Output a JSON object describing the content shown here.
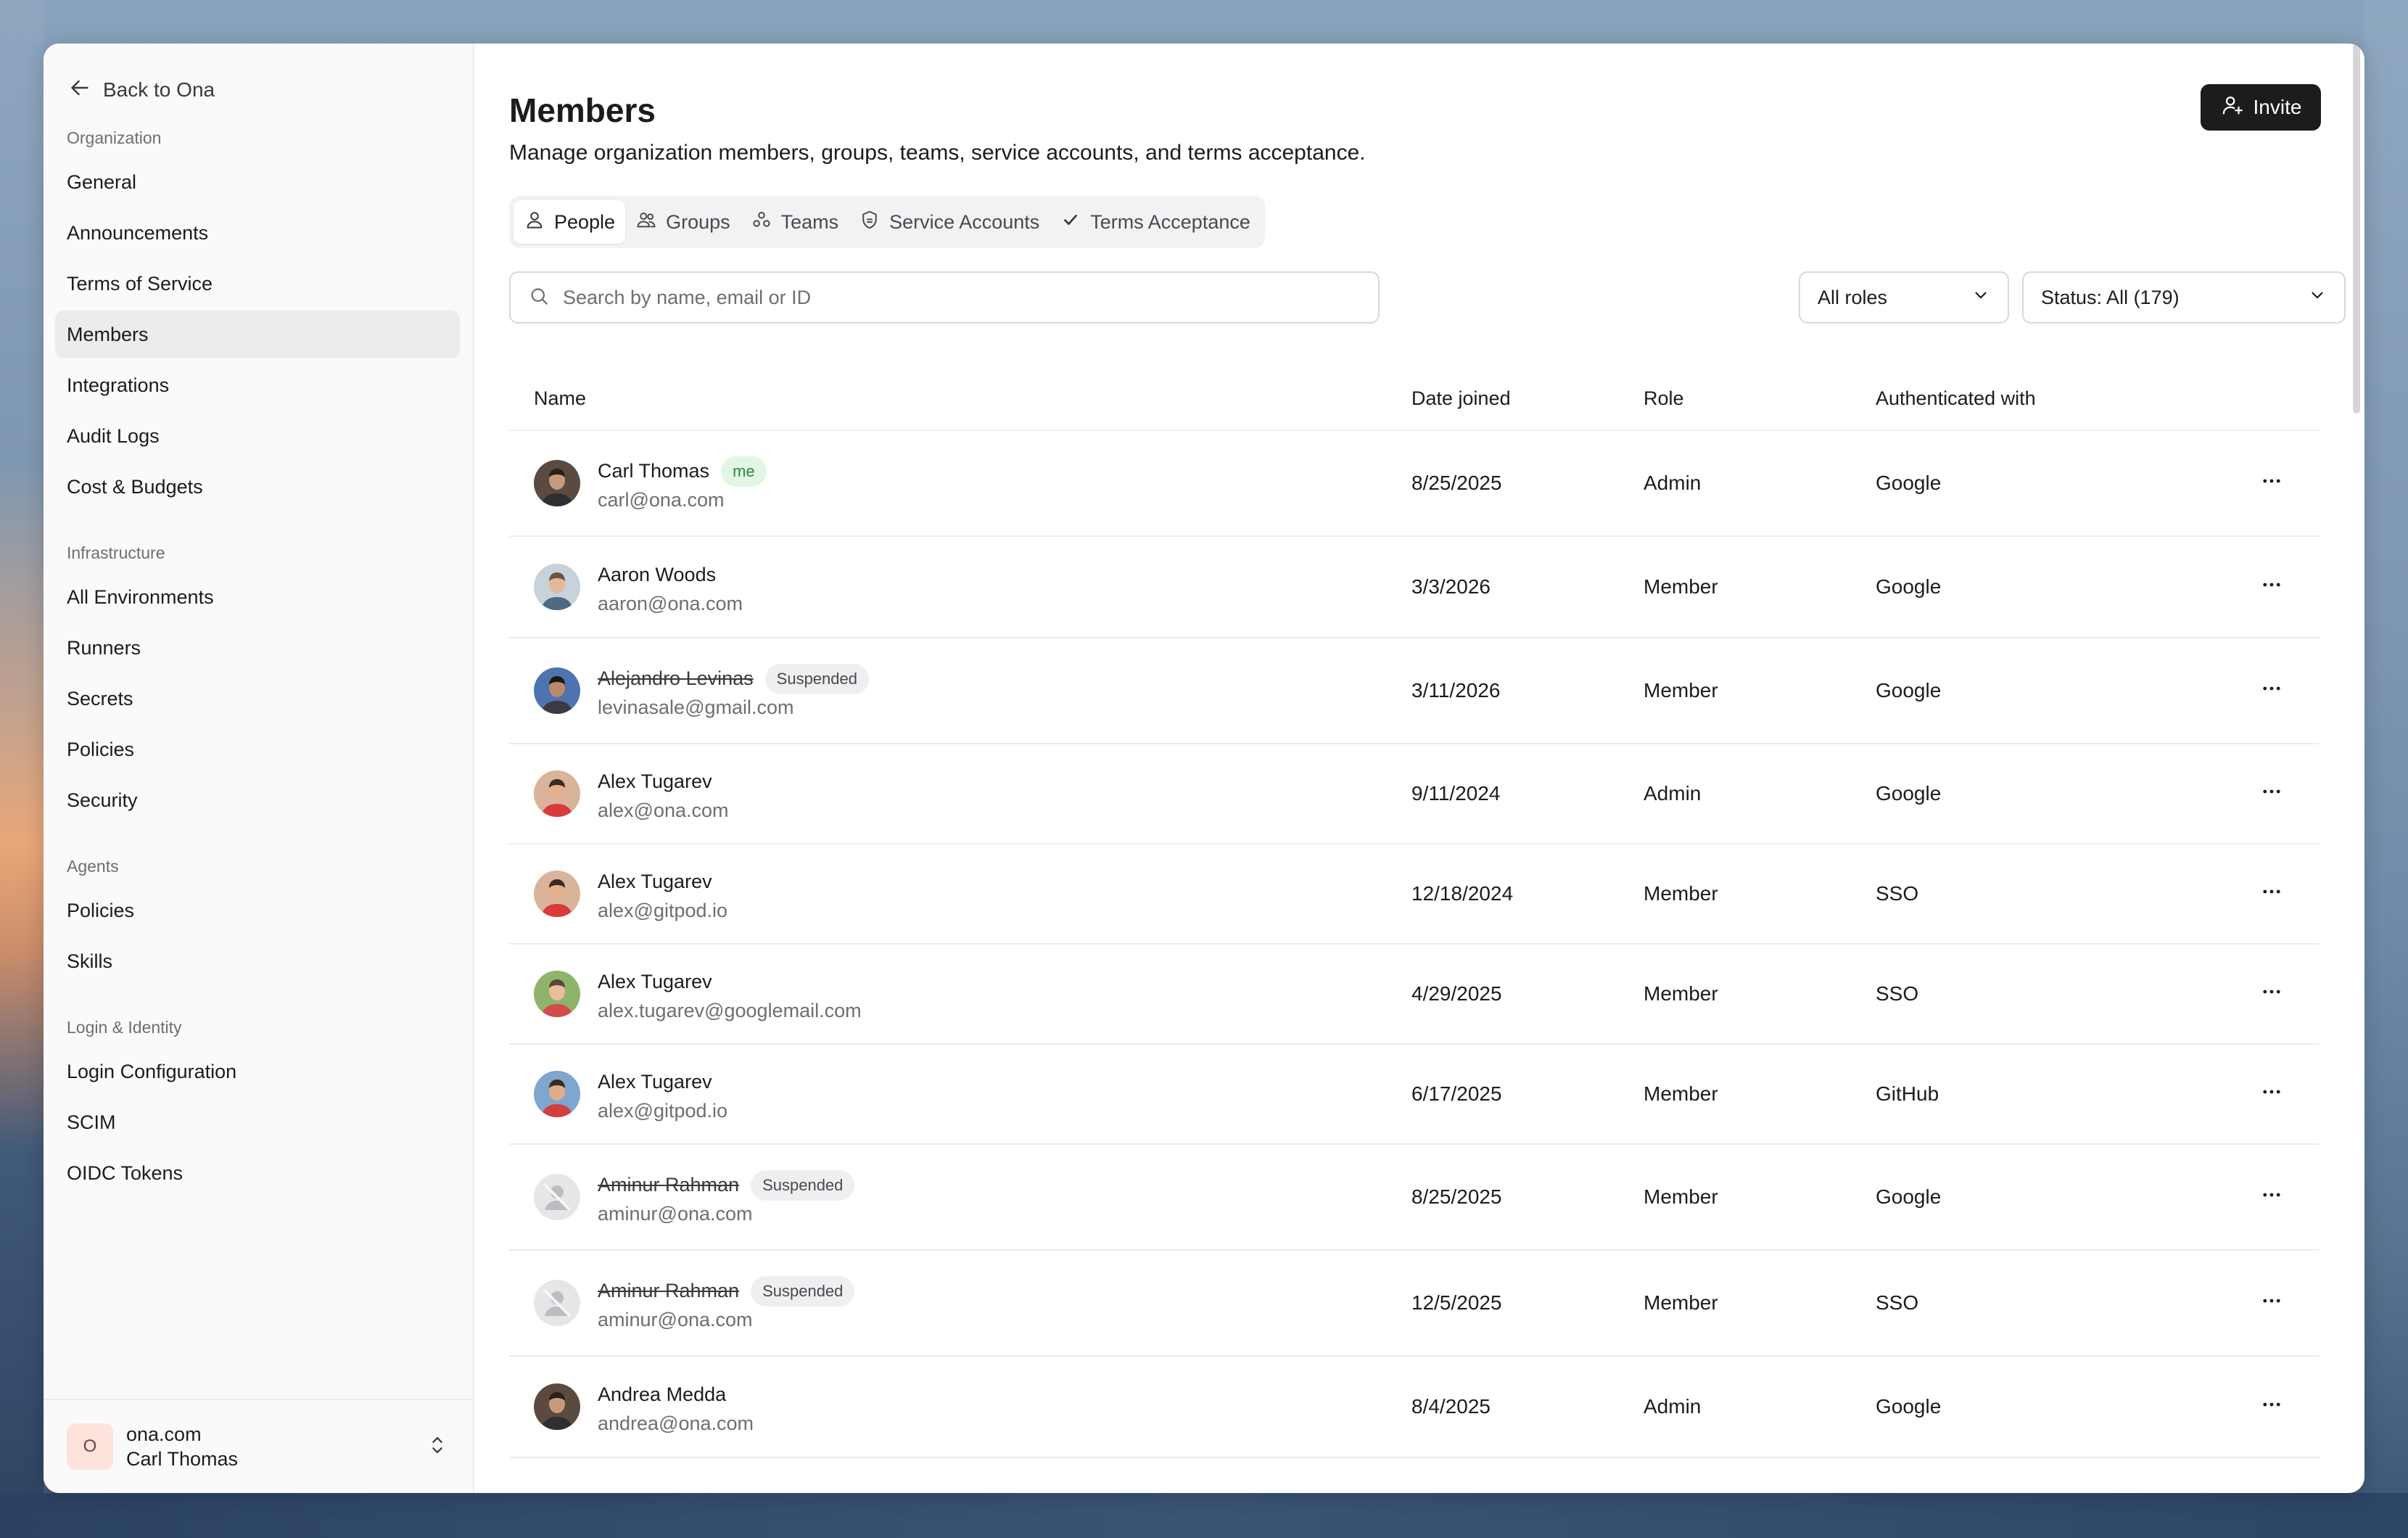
{
  "sidebar": {
    "back_label": "Back to Ona",
    "groups": [
      {
        "label": "Organization",
        "items": [
          "General",
          "Announcements",
          "Terms of Service",
          "Members",
          "Integrations",
          "Audit Logs",
          "Cost & Budgets"
        ]
      },
      {
        "label": "Infrastructure",
        "items": [
          "All Environments",
          "Runners",
          "Secrets",
          "Policies",
          "Security"
        ]
      },
      {
        "label": "Agents",
        "items": [
          "Policies",
          "Skills"
        ]
      },
      {
        "label": "Login & Identity",
        "items": [
          "Login Configuration",
          "SCIM",
          "OIDC Tokens"
        ]
      }
    ],
    "active_item": "Members",
    "org": {
      "avatar_letter": "O",
      "name": "ona.com",
      "user": "Carl Thomas"
    }
  },
  "header": {
    "title": "Members",
    "subtitle": "Manage organization members, groups, teams, service accounts, and terms acceptance.",
    "invite_label": "Invite"
  },
  "tabs": [
    {
      "label": "People",
      "icon": "user-icon",
      "active": true
    },
    {
      "label": "Groups",
      "icon": "users-icon",
      "active": false
    },
    {
      "label": "Teams",
      "icon": "teams-icon",
      "active": false
    },
    {
      "label": "Service Accounts",
      "icon": "shield-icon",
      "active": false
    },
    {
      "label": "Terms Acceptance",
      "icon": "check-icon",
      "active": false
    }
  ],
  "filters": {
    "search_placeholder": "Search by name, email or ID",
    "roles_value": "All roles",
    "status_value": "Status: All (179)"
  },
  "table": {
    "columns": [
      "Name",
      "Date joined",
      "Role",
      "Authenticated with"
    ],
    "rows": [
      {
        "name": "Carl Thomas",
        "email": "carl@ona.com",
        "badge": "me",
        "suspended": false,
        "date": "8/25/2025",
        "role": "Admin",
        "auth": "Google",
        "avatar": "photo-dark"
      },
      {
        "name": "Aaron Woods",
        "email": "aaron@ona.com",
        "badge": "",
        "suspended": false,
        "date": "3/3/2026",
        "role": "Member",
        "auth": "Google",
        "avatar": "photo-light"
      },
      {
        "name": "Alejandro Levinas",
        "email": "levinasale@gmail.com",
        "badge": "Suspended",
        "suspended": true,
        "date": "3/11/2026",
        "role": "Member",
        "auth": "Google",
        "avatar": "photo-blue"
      },
      {
        "name": "Alex Tugarev",
        "email": "alex@ona.com",
        "badge": "",
        "suspended": false,
        "date": "9/11/2024",
        "role": "Admin",
        "auth": "Google",
        "avatar": "photo-red"
      },
      {
        "name": "Alex Tugarev",
        "email": "alex@gitpod.io",
        "badge": "",
        "suspended": false,
        "date": "12/18/2024",
        "role": "Member",
        "auth": "SSO",
        "avatar": "photo-red"
      },
      {
        "name": "Alex Tugarev",
        "email": "alex.tugarev@googlemail.com",
        "badge": "",
        "suspended": false,
        "date": "4/29/2025",
        "role": "Member",
        "auth": "SSO",
        "avatar": "photo-green"
      },
      {
        "name": "Alex Tugarev",
        "email": "alex@gitpod.io",
        "badge": "",
        "suspended": false,
        "date": "6/17/2025",
        "role": "Member",
        "auth": "GitHub",
        "avatar": "photo-sky"
      },
      {
        "name": "Aminur Rahman",
        "email": "aminur@ona.com",
        "badge": "Suspended",
        "suspended": true,
        "date": "8/25/2025",
        "role": "Member",
        "auth": "Google",
        "avatar": "placeholder"
      },
      {
        "name": "Aminur Rahman",
        "email": "aminur@ona.com",
        "badge": "Suspended",
        "suspended": true,
        "date": "12/5/2025",
        "role": "Member",
        "auth": "SSO",
        "avatar": "placeholder"
      },
      {
        "name": "Andrea Medda",
        "email": "andrea@ona.com",
        "badge": "",
        "suspended": false,
        "date": "8/4/2025",
        "role": "Admin",
        "auth": "Google",
        "avatar": "photo-dark"
      }
    ]
  },
  "colors": {
    "accent_dark": "#1c1c1e",
    "me_badge_bg": "#e3f6e5",
    "me_badge_text": "#2b8a3e",
    "suspended_badge_bg": "#efeff1",
    "org_avatar_bg": "#fde3dc"
  }
}
